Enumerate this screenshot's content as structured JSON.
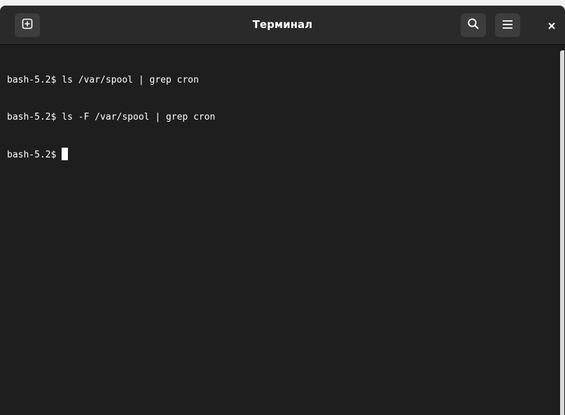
{
  "window": {
    "title": "Терминал"
  },
  "headerbar": {
    "new_tab_icon": "new-tab-icon",
    "search_icon": "search-icon",
    "menu_icon": "hamburger-menu-icon",
    "close_icon": "close-icon"
  },
  "terminal": {
    "lines": [
      "bash-5.2$ ls /var/spool | grep cron",
      "bash-5.2$ ls -F /var/spool | grep cron"
    ],
    "prompt": "bash-5.2$ "
  },
  "colors": {
    "background": "#1e1e1e",
    "headerbar": "#2a2a2a",
    "button": "#3d3d3d",
    "text": "#ffffff"
  }
}
